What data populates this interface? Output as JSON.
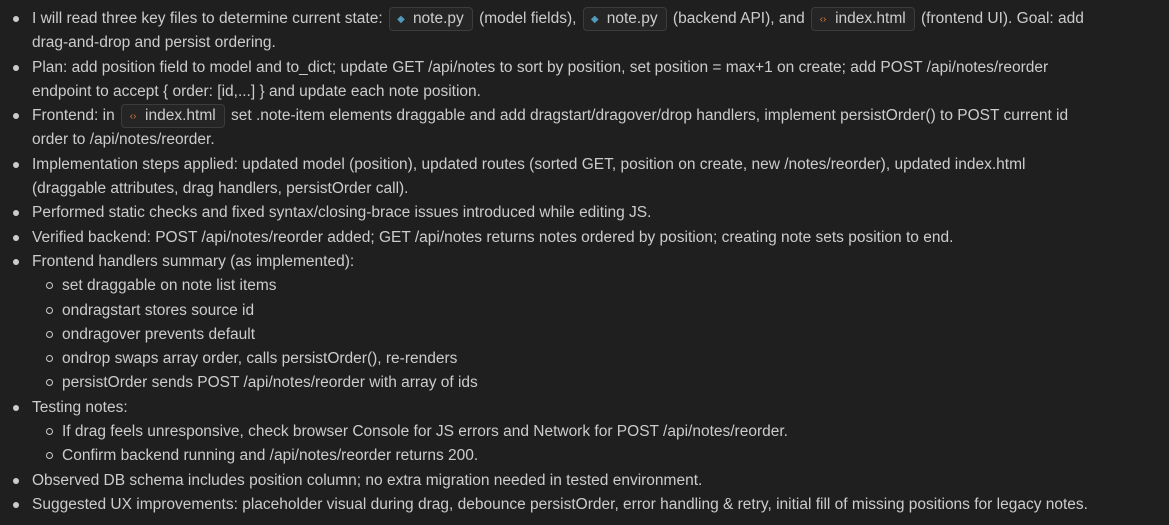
{
  "files": {
    "note_model": {
      "name": "note.py",
      "icon": "python-file-icon"
    },
    "note_api": {
      "name": "note.py",
      "icon": "python-file-icon"
    },
    "index_html": {
      "name": "index.html",
      "icon": "html-file-icon"
    }
  },
  "bullets": {
    "b1": {
      "t1": "I will read three key files to determine current state: ",
      "t2": " (model fields), ",
      "t3": " (backend API), and ",
      "t4": " (frontend UI). Goal: add",
      "t5": "drag-and-drop and persist ordering."
    },
    "b2": {
      "l1": "Plan: add position field to model and to_dict; update GET /api/notes to sort by position, set position = max+1 on create; add POST /api/notes/reorder",
      "l2": "endpoint to accept { order: [id,...] } and update each note position."
    },
    "b3": {
      "t1": "Frontend: in ",
      "t2": " set .note-item elements draggable and add dragstart/dragover/drop handlers, implement persistOrder() to POST current id",
      "t3": "order to /api/notes/reorder."
    },
    "b4": {
      "l1": "Implementation steps applied: updated model (position), updated routes (sorted GET, position on create, new /notes/reorder), updated index.html",
      "l2": "(draggable attributes, drag handlers, persistOrder call)."
    },
    "b5": "Performed static checks and fixed syntax/closing-brace issues introduced while editing JS.",
    "b6": "Verified backend: POST /api/notes/reorder added; GET /api/notes returns notes ordered by position; creating note sets position to end.",
    "b7": {
      "label": "Frontend handlers summary (as implemented):",
      "items": [
        "set draggable on note list items",
        "ondragstart stores source id",
        "ondragover prevents default",
        "ondrop swaps array order, calls persistOrder(), re-renders",
        "persistOrder sends POST /api/notes/reorder with array of ids"
      ]
    },
    "b8": {
      "label": "Testing notes:",
      "items": [
        "If drag feels unresponsive, check browser Console for JS errors and Network for POST /api/notes/reorder.",
        "Confirm backend running and /api/notes/reorder returns 200."
      ]
    },
    "b9": "Observed DB schema includes position column; no extra migration needed in tested environment.",
    "b10": "Suggested UX improvements: placeholder visual during drag, debounce persistOrder, error handling & retry, initial fill of missing positions for legacy notes."
  }
}
